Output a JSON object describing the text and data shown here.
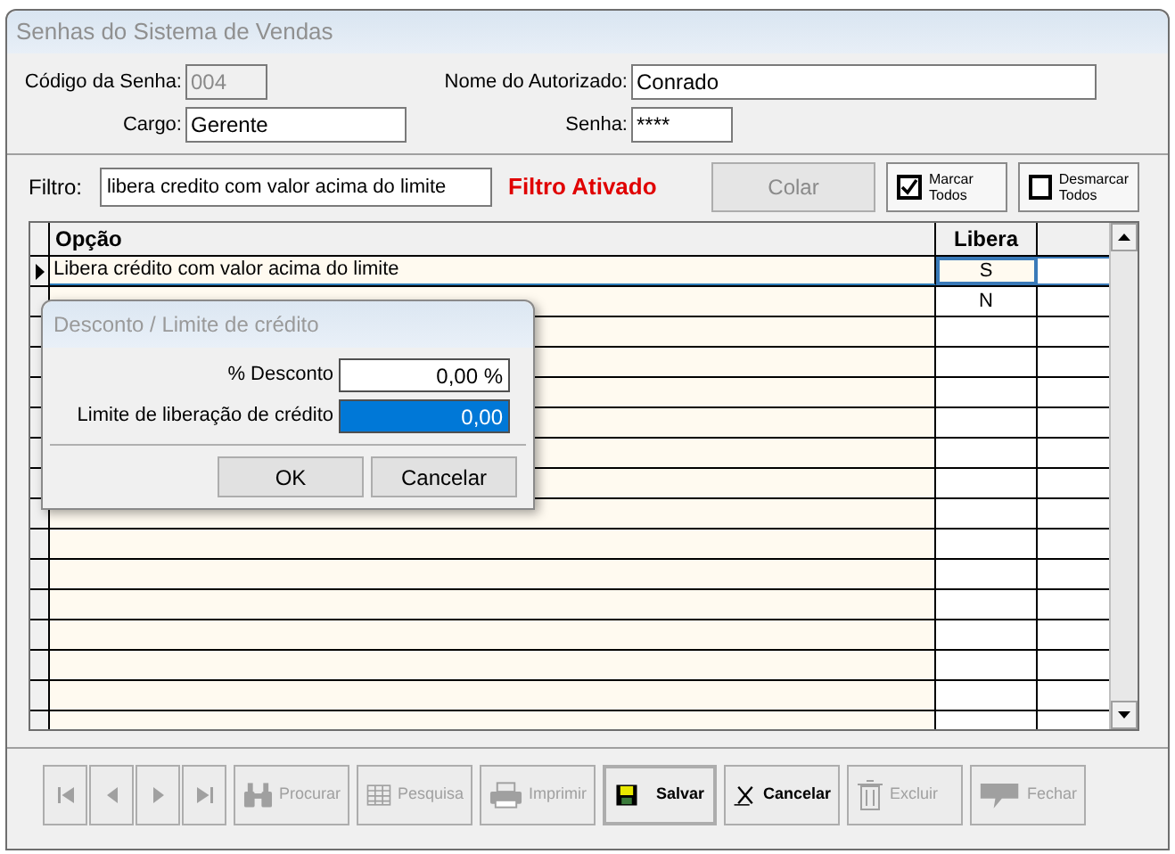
{
  "window": {
    "title": "Senhas do Sistema de Vendas"
  },
  "fields": {
    "codigo": {
      "label": "Código da Senha:",
      "value": "004",
      "disabled": true
    },
    "nome": {
      "label": "Nome do Autorizado:",
      "value": "Conrado",
      "disabled": false
    },
    "cargo": {
      "label": "Cargo:",
      "value": "Gerente",
      "disabled": false
    },
    "senha": {
      "label": "Senha:",
      "value": "****",
      "disabled": false
    }
  },
  "filter": {
    "label": "Filtro:",
    "value": "libera credito com valor acima do limite",
    "status": "Filtro Ativado"
  },
  "actions": [
    {
      "kind": "button",
      "label": "Colar",
      "disabled": true
    },
    {
      "kind": "check",
      "line1": "Marcar",
      "line2": "Todos",
      "checked": true
    },
    {
      "kind": "check",
      "line1": "Desmarcar",
      "line2": "Todos",
      "checked": false
    }
  ],
  "table": {
    "columns": [
      "Opção",
      "Libera"
    ],
    "rows": [
      {
        "opcao": "Libera crédito com valor acima do limite",
        "libera": "S",
        "selected": true
      },
      {
        "libera": "N",
        "selected": false
      }
    ]
  },
  "dialog": {
    "title": "Desconto / Limite de crédito",
    "fields": [
      {
        "label": "% Desconto",
        "value": "0,00 %",
        "selected": false
      },
      {
        "label": "Limite de liberação de crédito",
        "value": "0,00",
        "selected": true
      }
    ],
    "buttons": [
      "OK",
      "Cancelar"
    ]
  },
  "toolbar": [
    {
      "kind": "first",
      "disabled": true
    },
    {
      "kind": "prev",
      "disabled": true
    },
    {
      "kind": "next",
      "disabled": true
    },
    {
      "kind": "last",
      "disabled": true
    },
    {
      "kind": "binoculars",
      "label": "Procurar",
      "disabled": true
    },
    {
      "kind": "grid",
      "label": "Pesquisa",
      "disabled": true
    },
    {
      "kind": "printer",
      "label": "Imprimir",
      "disabled": true
    },
    {
      "kind": "save",
      "label": "Salvar",
      "disabled": false
    },
    {
      "kind": "cancel",
      "label": "Cancelar",
      "disabled": false
    },
    {
      "kind": "trash",
      "label": "Excluir",
      "disabled": true
    },
    {
      "kind": "exit",
      "label": "Fechar",
      "disabled": true
    }
  ]
}
